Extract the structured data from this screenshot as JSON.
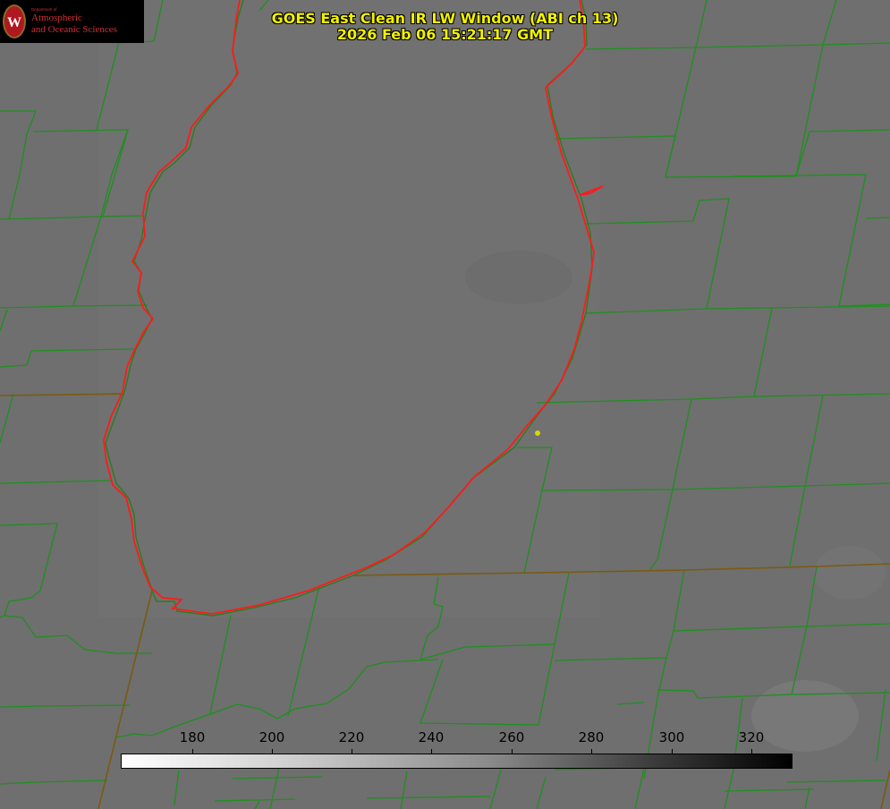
{
  "title": {
    "line1": "GOES East Clean IR LW Window (ABI ch 13)",
    "line2": "2026 Feb 06 15:21:17 GMT"
  },
  "logo": {
    "dept": "Department of",
    "line1": "Atmospheric",
    "line2": "and Oceanic Sciences"
  },
  "colorbar": {
    "min": 163,
    "max": 330,
    "ticks": [
      "180",
      "200",
      "220",
      "240",
      "260",
      "280",
      "300",
      "320"
    ]
  },
  "colors": {
    "background": "#6f6f6f",
    "county_lines": "#1f8f1f",
    "lake_outline": "#ff1a1a",
    "title_text": "#f2f200",
    "marker": "#d8d800"
  }
}
